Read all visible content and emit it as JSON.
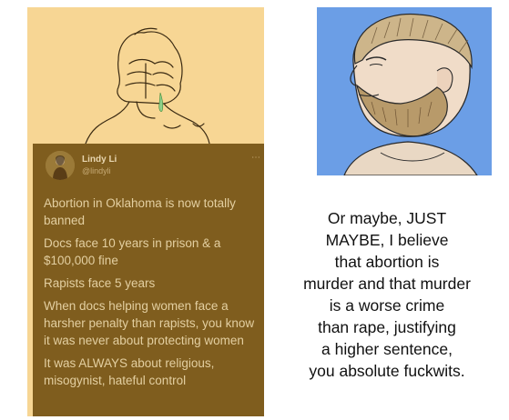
{
  "tweet": {
    "author_name": "Lindy Li",
    "author_handle": "@lindyli",
    "more_icon": "more-dots-icon",
    "paragraphs": [
      "Abortion in Oklahoma is now totally banned",
      "Docs face 10 years in prison & a $100,000 fine",
      "Rapists face 5 years",
      "When docs helping women face a harsher penalty than rapists, you know it was never about protecting women",
      "It was ALWAYS about religious, misogynist, hateful control"
    ]
  },
  "rebuttal": {
    "lines": [
      "Or maybe, JUST",
      "MAYBE, I believe",
      "that abortion is",
      "murder and that murder",
      "is a worse crime",
      "than rape, justifying",
      "a higher sentence,",
      "you absolute fuckwits."
    ]
  },
  "colors": {
    "left_background": "#f7d694",
    "tweet_background": "#7f5d1e",
    "right_background": "#6b9ee6",
    "tear": "#8fd08a",
    "beard": "#b89a6a"
  },
  "images": {
    "left_drawing": "crying-wojak-drawing",
    "right_drawing": "yes-chad-drawing"
  }
}
